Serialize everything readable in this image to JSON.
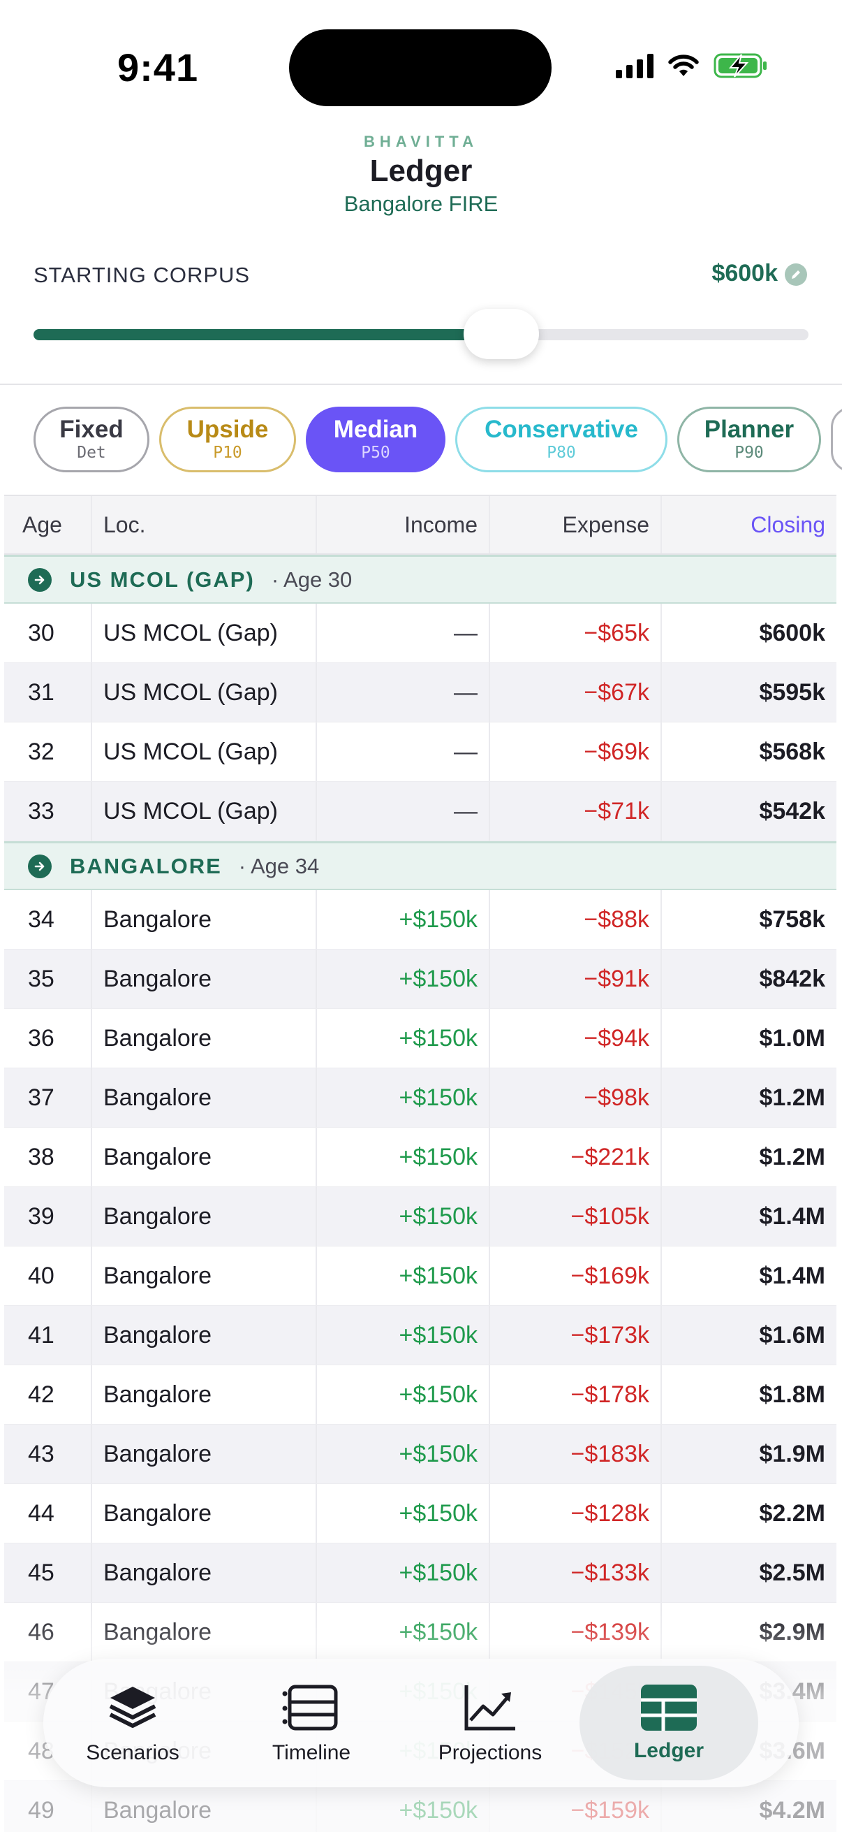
{
  "status_bar": {
    "time": "9:41"
  },
  "header": {
    "brand": "BHAVITTA",
    "title": "Ledger",
    "subtitle": "Bangalore FIRE"
  },
  "corpus": {
    "label": "STARTING CORPUS",
    "value": "$600k",
    "slider_fraction": 0.6
  },
  "scenarios": [
    {
      "label": "Fixed",
      "sub": "Det"
    },
    {
      "label": "Upside",
      "sub": "P10"
    },
    {
      "label": "Median",
      "sub": "P50",
      "selected": true
    },
    {
      "label": "Conservative",
      "sub": "P80"
    },
    {
      "label": "Planner",
      "sub": "P90"
    }
  ],
  "table": {
    "headers": {
      "age": "Age",
      "loc": "Loc.",
      "income": "Income",
      "expense": "Expense",
      "closing": "Closing"
    },
    "groups": [
      {
        "name": "US MCOL (GAP)",
        "age_label": "· Age 30",
        "rows": [
          {
            "age": "30",
            "loc": "US MCOL (Gap)",
            "income": "—",
            "expense": "−$65k",
            "closing": "$600k"
          },
          {
            "age": "31",
            "loc": "US MCOL (Gap)",
            "income": "—",
            "expense": "−$67k",
            "closing": "$595k"
          },
          {
            "age": "32",
            "loc": "US MCOL (Gap)",
            "income": "—",
            "expense": "−$69k",
            "closing": "$568k"
          },
          {
            "age": "33",
            "loc": "US MCOL (Gap)",
            "income": "—",
            "expense": "−$71k",
            "closing": "$542k"
          }
        ]
      },
      {
        "name": "BANGALORE",
        "age_label": "· Age 34",
        "rows": [
          {
            "age": "34",
            "loc": "Bangalore",
            "income": "+$150k",
            "expense": "−$88k",
            "closing": "$758k"
          },
          {
            "age": "35",
            "loc": "Bangalore",
            "income": "+$150k",
            "expense": "−$91k",
            "closing": "$842k"
          },
          {
            "age": "36",
            "loc": "Bangalore",
            "income": "+$150k",
            "expense": "−$94k",
            "closing": "$1.0M"
          },
          {
            "age": "37",
            "loc": "Bangalore",
            "income": "+$150k",
            "expense": "−$98k",
            "closing": "$1.2M"
          },
          {
            "age": "38",
            "loc": "Bangalore",
            "income": "+$150k",
            "expense": "−$221k",
            "closing": "$1.2M"
          },
          {
            "age": "39",
            "loc": "Bangalore",
            "income": "+$150k",
            "expense": "−$105k",
            "closing": "$1.4M"
          },
          {
            "age": "40",
            "loc": "Bangalore",
            "income": "+$150k",
            "expense": "−$169k",
            "closing": "$1.4M"
          },
          {
            "age": "41",
            "loc": "Bangalore",
            "income": "+$150k",
            "expense": "−$173k",
            "closing": "$1.6M"
          },
          {
            "age": "42",
            "loc": "Bangalore",
            "income": "+$150k",
            "expense": "−$178k",
            "closing": "$1.8M"
          },
          {
            "age": "43",
            "loc": "Bangalore",
            "income": "+$150k",
            "expense": "−$183k",
            "closing": "$1.9M"
          },
          {
            "age": "44",
            "loc": "Bangalore",
            "income": "+$150k",
            "expense": "−$128k",
            "closing": "$2.2M"
          },
          {
            "age": "45",
            "loc": "Bangalore",
            "income": "+$150k",
            "expense": "−$133k",
            "closing": "$2.5M"
          },
          {
            "age": "46",
            "loc": "Bangalore",
            "income": "+$150k",
            "expense": "−$139k",
            "closing": "$2.9M"
          },
          {
            "age": "47",
            "loc": "Bangalore",
            "income": "+$150k",
            "expense": "−$145k",
            "closing": "$3.4M"
          },
          {
            "age": "48",
            "loc": "Bangalore",
            "income": "+$150k",
            "expense": "−$152k",
            "closing": "$3.6M"
          },
          {
            "age": "49",
            "loc": "Bangalore",
            "income": "+$150k",
            "expense": "−$159k",
            "closing": "$4.2M"
          }
        ]
      }
    ]
  },
  "tabbar": [
    {
      "label": "Scenarios",
      "icon": "stack-icon"
    },
    {
      "label": "Timeline",
      "icon": "timeline-icon"
    },
    {
      "label": "Projections",
      "icon": "chart-trend-icon"
    },
    {
      "label": "Ledger",
      "icon": "table-icon",
      "active": true
    }
  ],
  "colors": {
    "brand_green": "#1e6b55",
    "accent_purple": "#6a54f6",
    "income_green": "#1f9a4c",
    "expense_red": "#d02626"
  }
}
